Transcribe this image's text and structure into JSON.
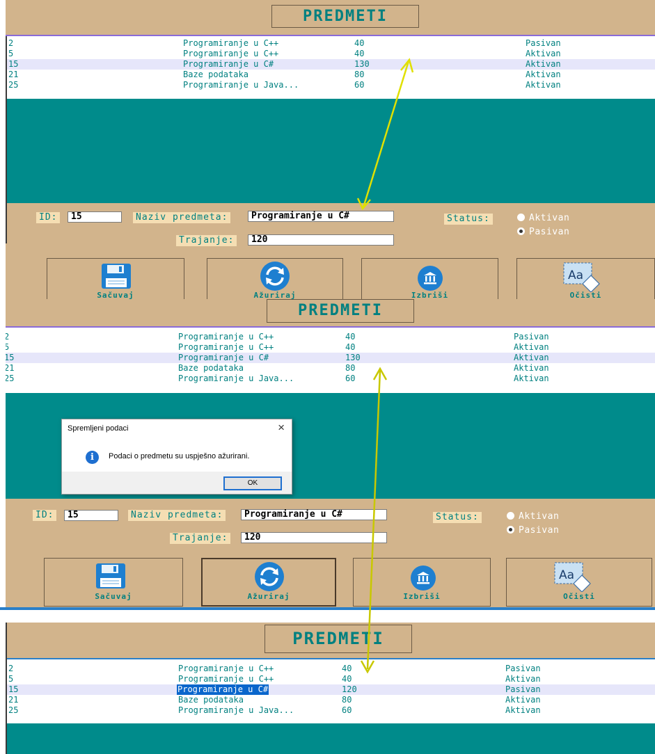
{
  "screens": [
    {
      "title": "PREDMETI",
      "rows": [
        {
          "id": "2",
          "name": "Programiranje u C++",
          "duration": "40",
          "status": "Pasivan"
        },
        {
          "id": "5",
          "name": "Programiranje u C++",
          "duration": "40",
          "status": "Aktivan"
        },
        {
          "id": "15",
          "name": "Programiranje u C#",
          "duration": "130",
          "status": "Aktivan"
        },
        {
          "id": "21",
          "name": "Baze podataka",
          "duration": "80",
          "status": "Aktivan"
        },
        {
          "id": "25",
          "name": "Programiranje u Java...",
          "duration": "60",
          "status": "Aktivan"
        }
      ],
      "form": {
        "id_label": "ID:",
        "id_value": "15",
        "naziv_label": "Naziv predmeta:",
        "naziv_value": "Programiranje u C#",
        "status_label": "Status:",
        "status_options": [
          "Aktivan",
          "Pasivan"
        ],
        "status_selected": "Pasivan",
        "trajanje_label": "Trajanje:",
        "trajanje_value": "120"
      },
      "buttons": {
        "save": "Sačuvaj",
        "update": "Ažuriraj",
        "delete": "Izbriši",
        "clear": "Očisti"
      }
    },
    {
      "title": "PREDMETI",
      "rows": [
        {
          "id": "2",
          "name": "Programiranje u C++",
          "duration": "40",
          "status": "Pasivan"
        },
        {
          "id": "5",
          "name": "Programiranje u C++",
          "duration": "40",
          "status": "Aktivan"
        },
        {
          "id": "15",
          "name": "Programiranje u C#",
          "duration": "130",
          "status": "Aktivan"
        },
        {
          "id": "21",
          "name": "Baze podataka",
          "duration": "80",
          "status": "Aktivan"
        },
        {
          "id": "25",
          "name": "Programiranje u Java...",
          "duration": "60",
          "status": "Aktivan"
        }
      ],
      "dialog": {
        "title": "Spremljeni podaci",
        "message": "Podaci o predmetu su uspješno ažurirani.",
        "ok": "OK",
        "close": "×",
        "icon": "i"
      },
      "form": {
        "id_label": "ID:",
        "id_value": "15",
        "naziv_label": "Naziv predmeta:",
        "naziv_value": "Programiranje u C#",
        "status_label": "Status:",
        "status_options": [
          "Aktivan",
          "Pasivan"
        ],
        "status_selected": "Pasivan",
        "trajanje_label": "Trajanje:",
        "trajanje_value": "120"
      },
      "buttons": {
        "save": "Sačuvaj",
        "update": "Ažuriraj",
        "delete": "Izbriši",
        "clear": "Očisti"
      }
    },
    {
      "title": "PREDMETI",
      "rows": [
        {
          "id": "2",
          "name": "Programiranje u C++",
          "duration": "40",
          "status": "Pasivan"
        },
        {
          "id": "5",
          "name": "Programiranje u C++",
          "duration": "40",
          "status": "Aktivan"
        },
        {
          "id": "15",
          "name": "Programiranje u C#",
          "duration": "120",
          "status": "Pasivan"
        },
        {
          "id": "21",
          "name": "Baze podataka",
          "duration": "80",
          "status": "Aktivan"
        },
        {
          "id": "25",
          "name": "Programiranje u Java...",
          "duration": "60",
          "status": "Aktivan"
        }
      ]
    }
  ],
  "colors": {
    "tan": "#D2B48C",
    "teal": "#008B8B",
    "text": "#008080",
    "arrow": "#e0e000"
  }
}
